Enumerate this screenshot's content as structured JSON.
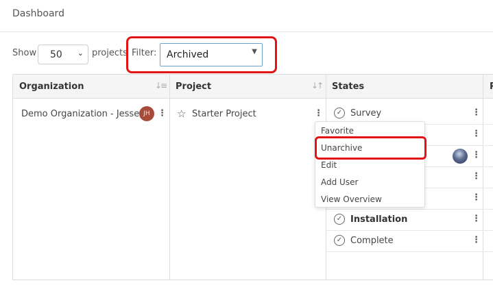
{
  "header": {
    "title": "Dashboard"
  },
  "controls": {
    "show_label": "Show",
    "page_size": "50",
    "projects_label": "projects",
    "filter_label": "Filter:",
    "filter_value": "Archived"
  },
  "table": {
    "columns": [
      "Organization",
      "Project",
      "States",
      "P"
    ],
    "organization": {
      "name": "Demo Organization - Jesse",
      "avatar_initials": "JH"
    },
    "project": {
      "name": "Starter Project"
    },
    "states": [
      {
        "label": "Survey",
        "bold": false,
        "checked": true
      },
      {
        "label": "",
        "bold": false,
        "checked": false
      },
      {
        "label": "",
        "bold": false,
        "checked": false
      },
      {
        "label": "",
        "bold": false,
        "checked": false
      },
      {
        "label": "",
        "bold": false,
        "checked": false
      },
      {
        "label": "Installation",
        "bold": true,
        "checked": true
      },
      {
        "label": "Complete",
        "bold": false,
        "checked": true
      }
    ]
  },
  "project_menu": {
    "items": [
      "Favorite",
      "Unarchive",
      "Edit",
      "Add User",
      "View Overview"
    ]
  },
  "colors": {
    "highlight": "#e41313",
    "avatar": "#a84a3a"
  }
}
